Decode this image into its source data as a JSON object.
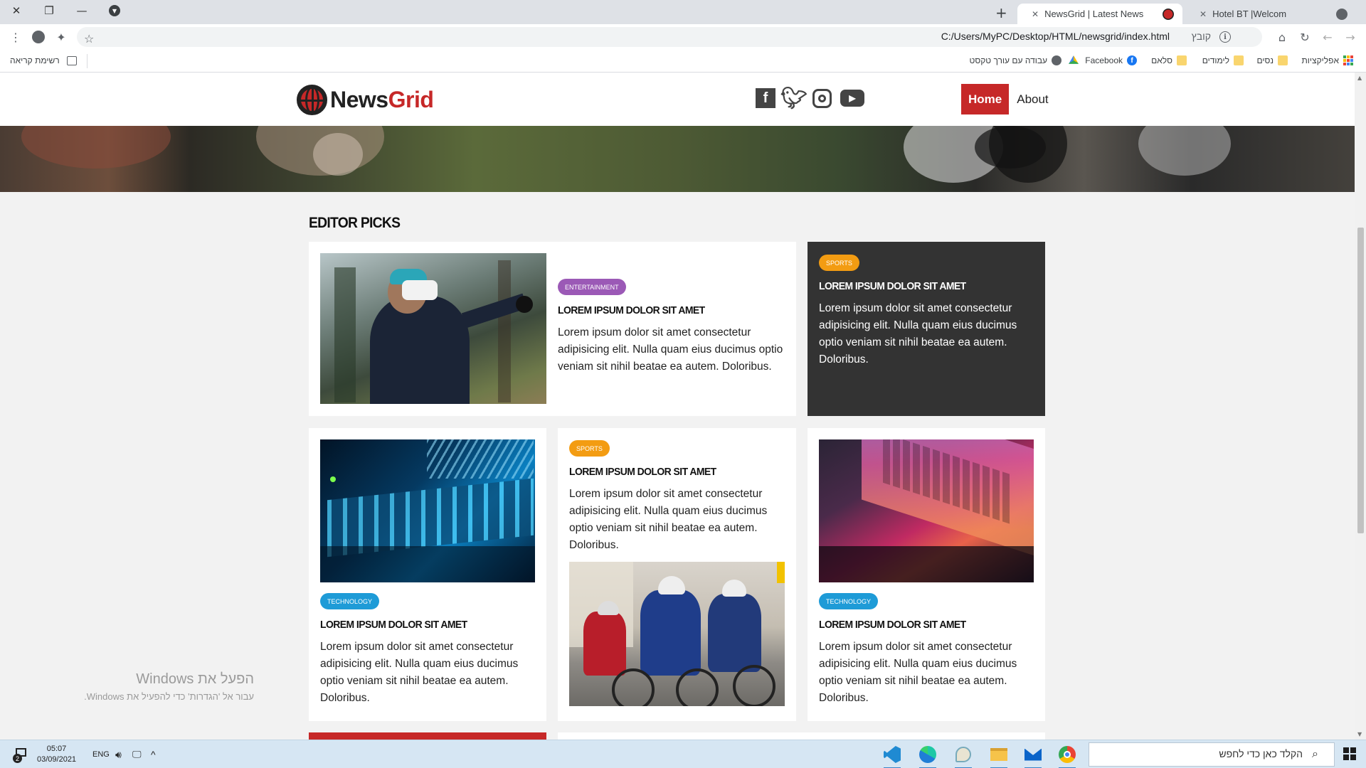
{
  "browser": {
    "tabs": [
      {
        "title": "NewsGrid | Latest News",
        "active": true
      },
      {
        "title": "Hotel BT |Welcom",
        "active": false
      }
    ],
    "url": "C:/Users/MyPC/Desktop/HTML/newsgrid/index.html",
    "url_label": "קובץ",
    "bookmarks": [
      {
        "label": "אפליקציות",
        "icon": "apps-icon"
      },
      {
        "label": "נסים",
        "icon": "folder-icon"
      },
      {
        "label": "לימודים",
        "icon": "folder-icon"
      },
      {
        "label": "סלאם",
        "icon": "folder-icon"
      },
      {
        "label": "Facebook",
        "icon": "facebook-icon"
      },
      {
        "label": "",
        "icon": "google-drive-icon"
      },
      {
        "label": "עבודה עם עורך טקסט",
        "icon": "globe-icon"
      }
    ],
    "reading_list": "רשימת קריאה"
  },
  "site": {
    "logo": {
      "part1": "News",
      "part2": "Grid"
    },
    "social": [
      "facebook-icon",
      "twitter-icon",
      "instagram-icon",
      "youtube-icon"
    ],
    "nav": {
      "home": "Home",
      "about": "About"
    },
    "section_title": "EDITOR PICKS",
    "cards": [
      {
        "tag": "Entertainment",
        "title": "LOREM IPSUM DOLOR SIT AMET",
        "text": "Lorem ipsum dolor sit amet consectetur adipisicing elit. Nulla quam eius ducimus optio veniam sit nihil beatae ea autem. Doloribus."
      },
      {
        "tag": "Sports",
        "title": "LOREM IPSUM DOLOR SIT AMET",
        "text": "Lorem ipsum dolor sit amet consectetur adipisicing elit. Nulla quam eius ducimus optio veniam sit nihil beatae ea autem. Doloribus."
      },
      {
        "tag": "Technology",
        "title": "LOREM IPSUM DOLOR SIT AMET",
        "text": "Lorem ipsum dolor sit amet consectetur adipisicing elit. Nulla quam eius ducimus optio veniam sit nihil beatae ea autem. Doloribus."
      },
      {
        "tag": "Sports",
        "title": "LOREM IPSUM DOLOR SIT AMET",
        "text": "Lorem ipsum dolor sit amet consectetur adipisicing elit. Nulla quam eius ducimus optio veniam sit nihil beatae ea autem. Doloribus."
      },
      {
        "tag": "Technology",
        "title": "LOREM IPSUM DOLOR SIT AMET",
        "text": "Lorem ipsum dolor sit amet consectetur adipisicing elit. Nulla quam eius ducimus optio veniam sit nihil beatae ea autem. Doloribus."
      }
    ],
    "colors": {
      "brand_red": "#c62828",
      "entertainment": "#9b59b6",
      "sports": "#f39c12",
      "technology": "#1e9bd7",
      "dark_card": "#333333"
    }
  },
  "watermark": {
    "title": "הפעל את Windows",
    "subtitle": "עבור אל 'הגדרות' כדי להפעיל את Windows."
  },
  "taskbar": {
    "time": "05:07",
    "date": "03/09/2021",
    "language": "ENG",
    "notification_count": "2",
    "search_placeholder": "הקלד כאן כדי לחפש",
    "apps": [
      "vscode-icon",
      "edge-icon",
      "paint-icon",
      "file-explorer-icon",
      "mail-icon",
      "chrome-icon"
    ]
  }
}
